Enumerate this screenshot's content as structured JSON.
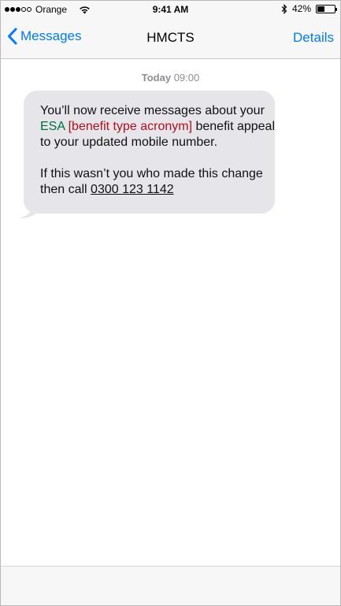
{
  "status_bar": {
    "carrier": "Orange",
    "time": "9:41 AM",
    "battery_percent": "42%",
    "battery_level": 0.42,
    "signal_bars_filled": 3,
    "signal_bars_total": 5,
    "icons": [
      "wifi-icon",
      "bluetooth-icon",
      "battery-icon"
    ]
  },
  "nav": {
    "back_label": "Messages",
    "title": "HMCTS",
    "details_label": "Details",
    "accent_color": "#007aff"
  },
  "timestamp": {
    "day": "Today",
    "time": "09:00"
  },
  "message": {
    "line1_prefix": "You’ll now receive messages about your",
    "acronym": "ESA",
    "placeholder": "[benefit type acronym]",
    "line1_suffix": "benefit appeal to your updated mobile number.",
    "line2_prefix": "If this wasn’t you who made this change then call",
    "phone_number": "0300 123 1142",
    "bubble_color": "#e5e5ea",
    "acronym_color": "#00703c",
    "placeholder_color": "#b10e1e"
  }
}
